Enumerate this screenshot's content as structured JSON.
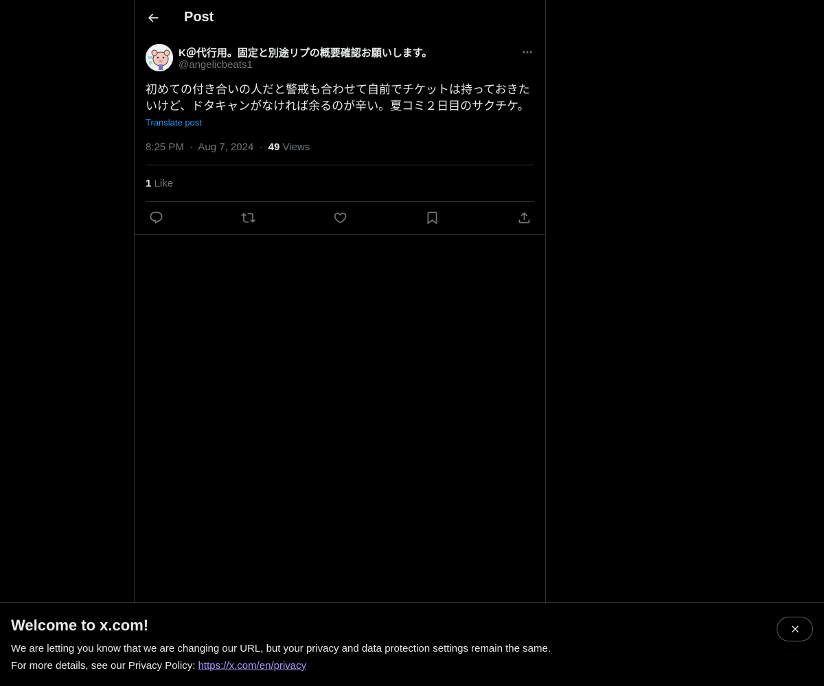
{
  "header": {
    "title": "Post",
    "back_icon": "arrow-left-icon"
  },
  "post": {
    "display_name": "K＠代行用。固定と別途リプの概要確認お願いします。",
    "handle": "@angelicbeats1",
    "text": "初めての付き合いの人だと警戒も合わせて自前でチケットは持っておきたいけど、ドタキャンがなければ余るのが辛い。夏コミ２日目のサクチケ。",
    "translate_label": "Translate post",
    "time": "8:25 PM",
    "date": "Aug 7, 2024",
    "views_count": "49",
    "views_label": "Views",
    "likes_count": "1",
    "likes_label": "Like",
    "separator": "·"
  },
  "actions": {
    "reply_icon": "reply-icon",
    "repost_icon": "repost-icon",
    "like_icon": "heart-icon",
    "bookmark_icon": "bookmark-icon",
    "share_icon": "share-icon"
  },
  "banner": {
    "title": "Welcome to x.com!",
    "line1": "We are letting you know that we are changing our URL, but your privacy and data protection settings remain the same.",
    "line2_prefix": "For more details, see our Privacy Policy: ",
    "link": "https://x.com/en/privacy"
  },
  "colors": {
    "background": "#000000",
    "text": "#e7e9ea",
    "muted": "#71767b",
    "accent": "#1d9bf0",
    "link": "#a899ff",
    "border": "#2f3336"
  }
}
